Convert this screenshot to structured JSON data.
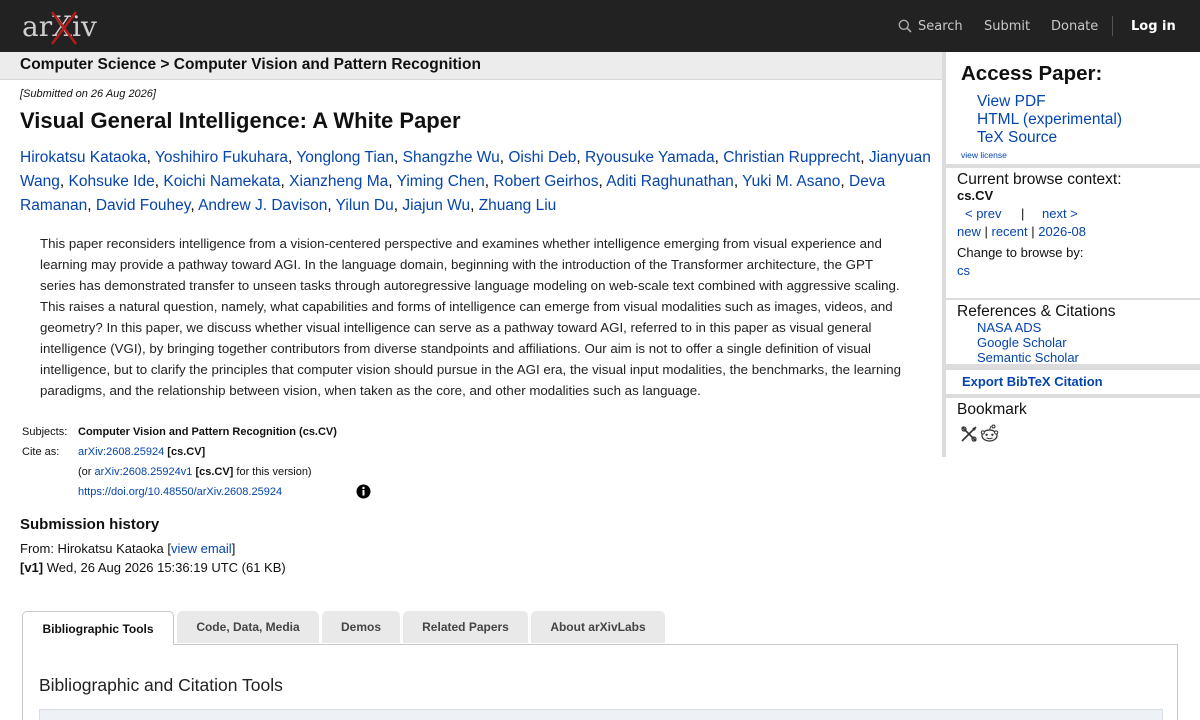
{
  "header": {
    "logo_text": "arXiv",
    "nav": {
      "search": "Search",
      "submit": "Submit",
      "donate": "Donate",
      "login": "Log in"
    }
  },
  "breadcrumb": "Computer Science > Computer Vision and Pattern Recognition",
  "paper": {
    "submitted": "[Submitted on 26 Aug 2026]",
    "title": "Visual General Intelligence: A White Paper",
    "authors": [
      "Hirokatsu Kataoka",
      "Yoshihiro Fukuhara",
      "Yonglong Tian",
      "Shangzhe Wu",
      "Oishi Deb",
      "Ryousuke Yamada",
      "Christian Rupprecht",
      "Jianyuan Wang",
      "Kohsuke Ide",
      "Koichi Namekata",
      "Xianzheng Ma",
      "Yiming Chen",
      "Robert Geirhos",
      "Aditi Raghunathan",
      "Yuki M. Asano",
      "Deva Ramanan",
      "David Fouhey",
      "Andrew J. Davison",
      "Yilun Du",
      "Jiajun Wu",
      "Zhuang Liu"
    ],
    "abstract": "This paper reconsiders intelligence from a vision-centered perspective and examines whether intelligence emerging from visual experience and learning may provide a pathway toward AGI. In the language domain, beginning with the introduction of the Transformer architecture, the GPT series has demonstrated transfer to unseen tasks through autoregressive language modeling on web-scale text combined with aggressive scaling. This raises a natural question, namely, what capabilities and forms of intelligence can emerge from visual modalities such as images, videos, and geometry? In this paper, we discuss whether visual intelligence can serve as a pathway toward AGI, referred to in this paper as visual general intelligence (VGI), by bringing together contributors from diverse standpoints and affiliations. Our aim is not to offer a single definition of visual intelligence, but to clarify the principles that computer vision should pursue in the AGI era, the visual input modalities, the benchmarks, the learning paradigms, and the relationship between vision, when taken as the core, and other modalities such as language."
  },
  "metadata": {
    "subjects_label": "Subjects:",
    "subjects_value": "Computer Vision and Pattern Recognition (cs.CV)",
    "cite_label": "Cite as:",
    "cite_id": "arXiv:2608.25924",
    "cite_cat": "[cs.CV]",
    "version_prefix": "(or",
    "version_id": "arXiv:2608.25924v1",
    "version_cat": "[cs.CV]",
    "version_suffix": "for this version)",
    "doi": "https://doi.org/10.48550/arXiv.2608.25924"
  },
  "history": {
    "title": "Submission history",
    "from_prefix": "From: Hirokatsu Kataoka [",
    "view_email": "view email",
    "from_suffix": "]",
    "version_tag": "[v1]",
    "version_text": "Wed, 26 Aug 2026 15:36:19 UTC (61 KB)"
  },
  "tabs": [
    {
      "label": "Bibliographic Tools",
      "active": true
    },
    {
      "label": "Code, Data, Media",
      "active": false
    },
    {
      "label": "Demos",
      "active": false
    },
    {
      "label": "Related Papers",
      "active": false
    },
    {
      "label": "About arXivLabs",
      "active": false
    }
  ],
  "panel": {
    "title": "Bibliographic and Citation Tools"
  },
  "sidebar": {
    "access": {
      "title": "Access Paper:",
      "links": [
        "View PDF",
        "HTML (experimental)",
        "TeX Source"
      ],
      "license": "view license"
    },
    "browse": {
      "title": "Current browse context:",
      "context": "cs.CV",
      "prev": "< prev",
      "pipe": "|",
      "next": "next >",
      "new": "new",
      "recent": "recent",
      "month": "2026-08",
      "change_label": "Change to browse by:",
      "cs": "cs"
    },
    "refs": {
      "title": "References & Citations",
      "links": [
        "NASA ADS",
        "Google Scholar",
        "Semantic Scholar"
      ]
    },
    "export": "Export BibTeX Citation",
    "bookmark": {
      "title": "Bookmark",
      "icons": [
        "bibsonomy-icon",
        "reddit-icon"
      ]
    }
  },
  "colors": {
    "header_bg": "#222222",
    "link": "#0645ad",
    "logo_x": "#b31b1b"
  }
}
